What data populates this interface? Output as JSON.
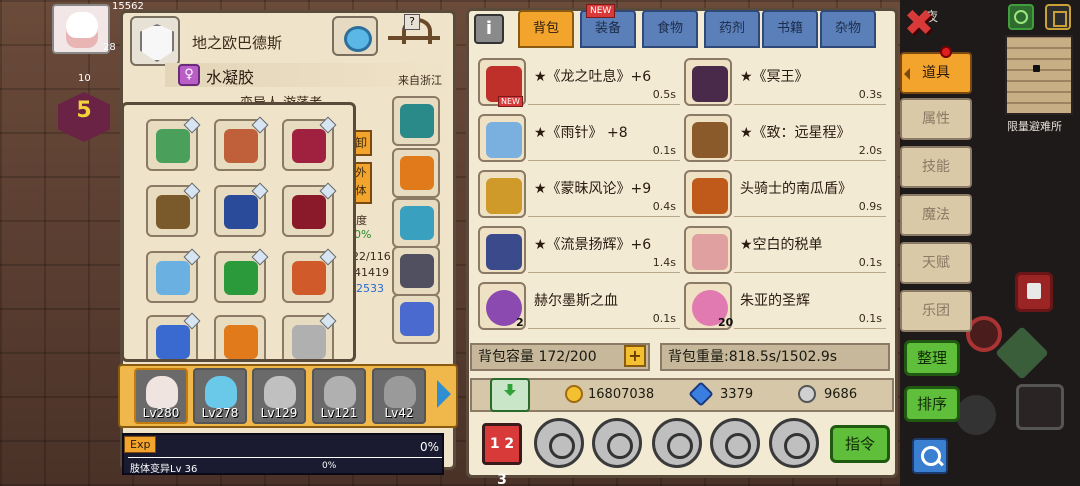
{
  "hud": {
    "score_partial": "15562",
    "num_a": "10",
    "num_b": "28",
    "level": "5",
    "night_label": "夜",
    "shelter_label": "限量避难所"
  },
  "character": {
    "name": "地之欧巴德斯",
    "title": "水凝胶",
    "title_icon": "♀",
    "origin": "来自浙江",
    "variant_label": "变异人 游荡者",
    "hint_q": "?"
  },
  "equipment_panel": {
    "side_buttons": [
      "卸",
      "外\n体"
    ],
    "stat_fragments": [
      "度",
      "0%",
      "22/116",
      "41419",
      "2533"
    ]
  },
  "equipment_slots": [
    {
      "name": "green-device",
      "color": "#4aa05a"
    },
    {
      "name": "ornate-amulet",
      "color": "#c0603a"
    },
    {
      "name": "crest-shield",
      "color": "#a02040"
    },
    {
      "name": "rope-necklace",
      "color": "#7a5a2a"
    },
    {
      "name": "blue-armor",
      "color": "#2a4a9a"
    },
    {
      "name": "dark-cloak",
      "color": "#8a1a2a"
    },
    {
      "name": "ice-cannon",
      "color": "#6ab0e0"
    },
    {
      "name": "green-crossbow",
      "color": "#2a9a3a"
    },
    {
      "name": "fire-blade",
      "color": "#d05a2a"
    },
    {
      "name": "blue-spear",
      "color": "#3a6ad0"
    },
    {
      "name": "pumpkin-leaf",
      "color": "#e07a1a"
    },
    {
      "name": "silver-axe",
      "color": "#b0b0b0"
    }
  ],
  "side_slots": [
    {
      "name": "crystal-gem",
      "color": "#2a8a8a"
    },
    {
      "name": "pumpkin",
      "color": "#e07a1a"
    },
    {
      "name": "ring-orb",
      "color": "#3aa0c0"
    },
    {
      "name": "mech-armor",
      "color": "#505060"
    },
    {
      "name": "robot-pet",
      "color": "#4a6ad0"
    }
  ],
  "party": [
    {
      "level": "Lv280",
      "color": "#f0e4e0"
    },
    {
      "level": "Lv278",
      "color": "#6ac8e8"
    },
    {
      "level": "Lv129",
      "color": "#c0c0c0"
    },
    {
      "level": "Lv121",
      "color": "#b0b0b0"
    },
    {
      "level": "Lv42",
      "color": "#9a9a9a"
    }
  ],
  "exp": {
    "label": "Exp",
    "percent": "0%",
    "mutation_label": "肢体变异Lv 36",
    "mutation_percent": "0%"
  },
  "inventory": {
    "info_icon": "i",
    "tabs": [
      {
        "label": "背包",
        "active": true
      },
      {
        "label": "装备",
        "new": "NEW"
      },
      {
        "label": "食物"
      },
      {
        "label": "药剂"
      },
      {
        "label": "书籍"
      },
      {
        "label": "杂物"
      }
    ],
    "items": [
      {
        "name": "★《龙之吐息》+6",
        "time": "0.5s",
        "new": "NEW",
        "color": "#c0302a"
      },
      {
        "name": "★《冥王》",
        "time": "0.3s",
        "color": "#4a2a4a"
      },
      {
        "name": "★《雨针》 +8",
        "time": "0.1s",
        "color": "#7ab0e0"
      },
      {
        "name": "★《致：远星程》",
        "time": "2.0s",
        "color": "#8a5a2a"
      },
      {
        "name": "★《蒙昧风论》+9",
        "time": "0.4s",
        "color": "#d09a2a"
      },
      {
        "name": "头骑士的南瓜盾》",
        "time": "0.9s",
        "color": "#c05a1a"
      },
      {
        "name": "★《流景扬辉》+6",
        "time": "1.4s",
        "color": "#3a4a8a"
      },
      {
        "name": "★空白的税单",
        "time": "0.1s",
        "color": "#e0a0a0"
      },
      {
        "name": "赫尔墨斯之血",
        "time": "0.1s",
        "qty": "2",
        "color": "#8a4ab0"
      },
      {
        "name": "朱亚的圣辉",
        "time": "0.1s",
        "qty": "20",
        "color": "#e07ab0"
      }
    ],
    "capacity": "背包容量 172/200",
    "capacity_plus": "+",
    "weight": "背包重量:818.5s/1502.9s",
    "gold": "16807038",
    "diamond": "3379",
    "silver": "9686",
    "rank_label": "1 2 3",
    "command_label": "指令"
  },
  "side_tabs": [
    {
      "label": "道具",
      "active": true
    },
    {
      "label": "属性"
    },
    {
      "label": "技能"
    },
    {
      "label": "魔法"
    },
    {
      "label": "天赋"
    },
    {
      "label": "乐团"
    }
  ],
  "right_buttons": {
    "close": "✖",
    "organize": "整理",
    "sort": "排序"
  }
}
